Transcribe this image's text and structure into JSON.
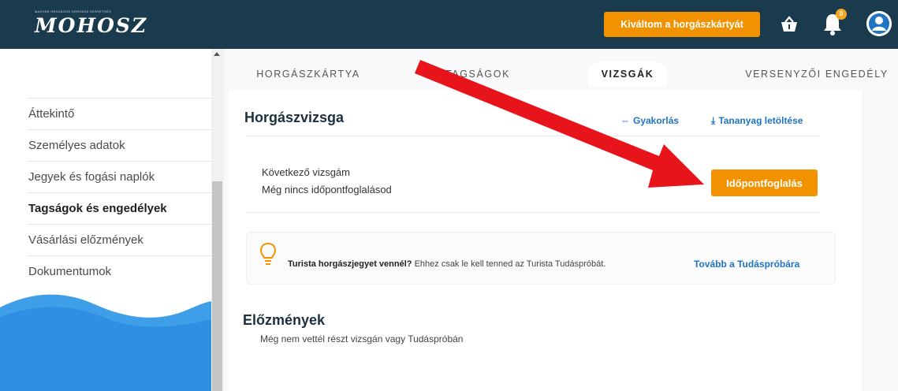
{
  "header": {
    "logo_tagline": "MAGYAR ORSZÁGOS HORGÁSZ SZÖVETSÉG",
    "logo_text": "MOHOSZ",
    "cta_label": "Kiváltom a horgászkártyát",
    "notification_count": "0",
    "colors": {
      "bar": "#1a3a4e",
      "accent": "#f39200"
    },
    "icons": [
      "basket-icon",
      "bell-icon",
      "user-avatar-icon"
    ]
  },
  "sidebar": {
    "items": [
      {
        "label": "Áttekintő",
        "active": false
      },
      {
        "label": "Személyes adatok",
        "active": false
      },
      {
        "label": "Jegyek és fogási naplók",
        "active": false
      },
      {
        "label": "Tagságok és engedélyek",
        "active": true
      },
      {
        "label": "Vásárlási előzmények",
        "active": false
      },
      {
        "label": "Dokumentumok",
        "active": false
      }
    ]
  },
  "tabs": [
    {
      "label": "HORGÁSZKÁRTYA",
      "active": false
    },
    {
      "label": "TAGSÁGOK",
      "active": false
    },
    {
      "label": "VIZSGÁK",
      "active": true
    },
    {
      "label": "VERSENYZŐI ENGEDÉLY",
      "active": false
    }
  ],
  "exam": {
    "title": "Horgászvizsga",
    "practice_link": "Gyakorlás",
    "download_link": "Tananyag letöltése",
    "next_exam_label": "Következő vizsgám",
    "next_exam_value": "Még nincs időpontfoglalásod",
    "book_button": "Időpontfoglalás"
  },
  "info": {
    "bold_text": "Turista horgászjegyet vennél?",
    "text": " Ehhez csak le kell tenned az Turista Tudáspróbát.",
    "link": "Tovább a Tudáspróbára"
  },
  "history": {
    "title": "Előzmények",
    "text": "Még nem vettél részt vizsgán vagy Tudáspróbán"
  }
}
